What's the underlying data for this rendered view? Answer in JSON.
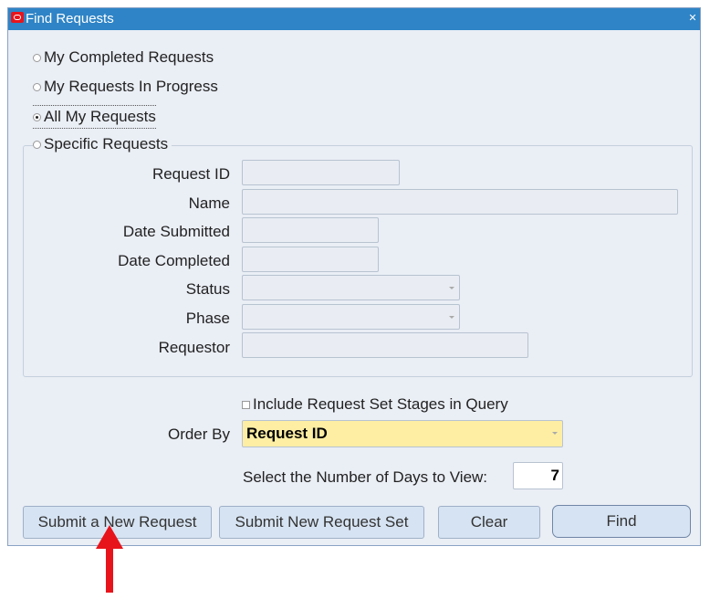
{
  "window": {
    "title": "Find Requests"
  },
  "radios": [
    {
      "label": "My Completed Requests",
      "selected": false
    },
    {
      "label": "My Requests In Progress",
      "selected": false
    },
    {
      "label": "All My Requests",
      "selected": true
    },
    {
      "label": "Specific Requests",
      "selected": false
    }
  ],
  "fields": {
    "request_id": {
      "label": "Request ID",
      "value": ""
    },
    "name": {
      "label": "Name",
      "value": ""
    },
    "date_submitted": {
      "label": "Date Submitted",
      "value": ""
    },
    "date_completed": {
      "label": "Date Completed",
      "value": ""
    },
    "status": {
      "label": "Status",
      "value": ""
    },
    "phase": {
      "label": "Phase",
      "value": ""
    },
    "requestor": {
      "label": "Requestor",
      "value": ""
    }
  },
  "include_stages": {
    "label": "Include Request Set Stages in Query",
    "checked": false
  },
  "order_by": {
    "label": "Order By",
    "value": "Request ID"
  },
  "days": {
    "label": "Select the Number of Days to View:",
    "value": "7"
  },
  "buttons": {
    "submit_request": "Submit a New Request",
    "submit_set": "Submit New Request Set",
    "clear": "Clear",
    "find": "Find"
  },
  "colors": {
    "titlebar": "#2e84c6",
    "order_by_bg": "#fdeea4",
    "arrow": "#e8141b"
  }
}
